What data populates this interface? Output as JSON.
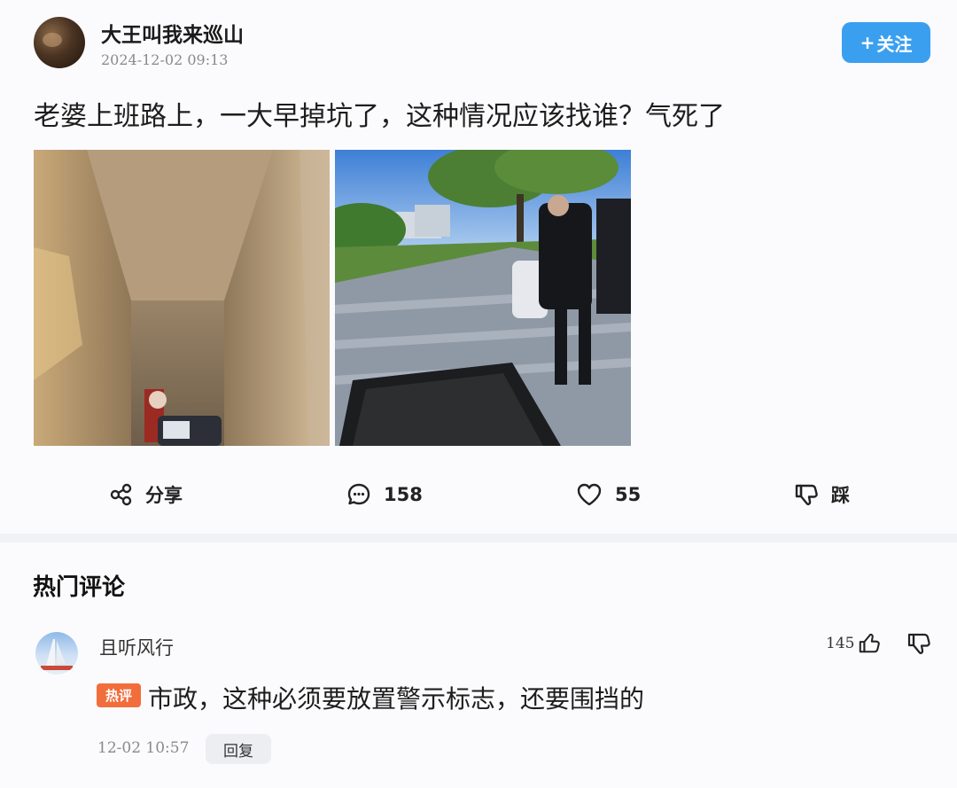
{
  "post": {
    "username": "大王叫我来巡山",
    "timestamp": "2024-12-02 09:13",
    "follow_label": "关注",
    "follow_plus": "+",
    "text": "老婆上班路上，一大早掉坑了，这种情况应该找谁？气死了",
    "images": [
      {
        "icon": "pit-photo"
      },
      {
        "icon": "street-photo"
      }
    ]
  },
  "actions": {
    "share": {
      "icon": "share-icon",
      "label": "分享"
    },
    "comment": {
      "icon": "comment-icon",
      "label": "158"
    },
    "like": {
      "icon": "heart-icon",
      "label": "55"
    },
    "dislike": {
      "icon": "thumbs-down-icon",
      "label": "踩"
    }
  },
  "comments_section": {
    "title": "热门评论",
    "items": [
      {
        "name": "且听风行",
        "likes": "145",
        "badge": "热评",
        "text": "市政，这种必须要放置警示标志，还要围挡的",
        "time": "12-02 10:57",
        "reply_label": "回复"
      }
    ]
  },
  "colors": {
    "accent": "#3b9ff0",
    "hot_badge": "#f26d3c",
    "background": "#fbfbfd",
    "divider": "#f1f2f5"
  }
}
